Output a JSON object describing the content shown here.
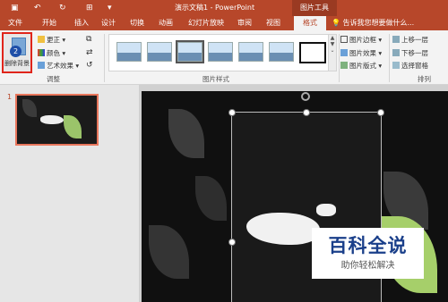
{
  "window": {
    "title": "演示文稿1 - PowerPoint",
    "context_tab": "图片工具"
  },
  "tabs": [
    "文件",
    "开始",
    "插入",
    "设计",
    "切换",
    "动画",
    "幻灯片放映",
    "审阅",
    "视图",
    "格式"
  ],
  "active_tab": "格式",
  "tell_me": "告诉我您想要做什么...",
  "ribbon": {
    "remove_bg": "删除背景",
    "adjust": {
      "corrections": "更正",
      "color": "颜色",
      "artistic": "艺术效果",
      "label": "调整"
    },
    "picture_styles_label": "图片样式",
    "picture_options": {
      "border": "图片边框",
      "effects": "图片效果",
      "layout": "图片版式"
    },
    "arrange": {
      "bring_forward": "上移一层",
      "send_backward": "下移一层",
      "selection_pane": "选择窗格",
      "label": "排列"
    }
  },
  "badge_number": "2",
  "slide_number": "1",
  "watermark": {
    "title": "百科全说",
    "subtitle": "助你轻松解决"
  }
}
